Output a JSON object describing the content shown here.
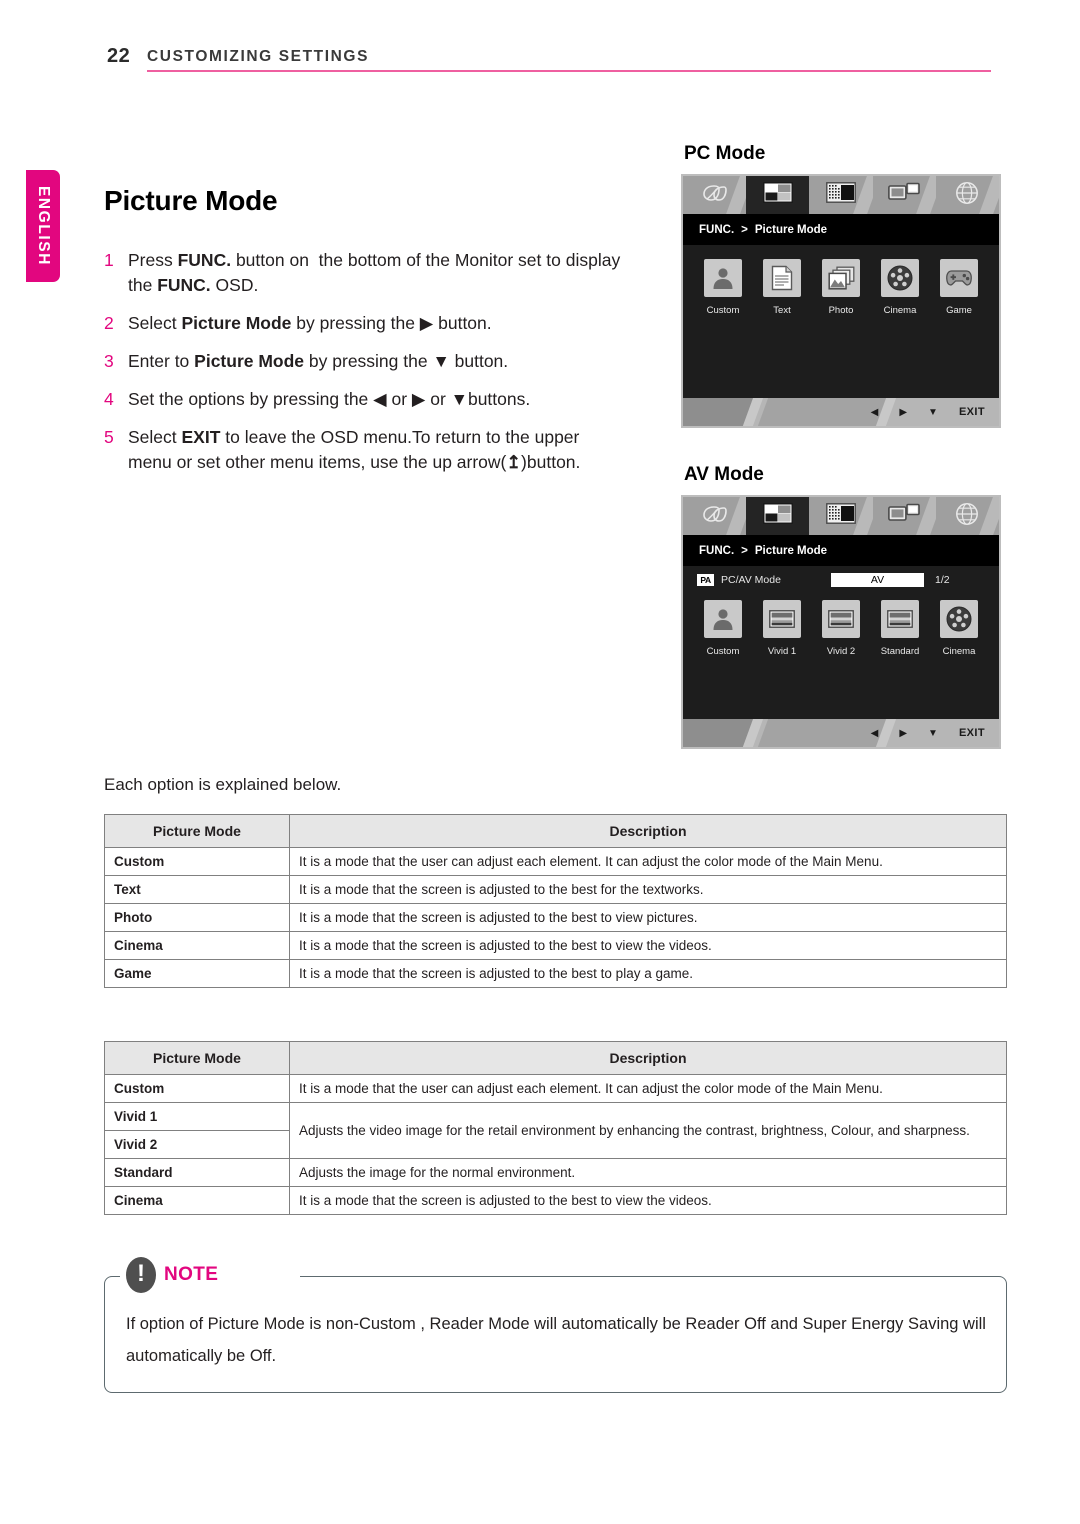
{
  "header": {
    "page_number": "22",
    "title": "CUSTOMIZING SETTINGS",
    "rule_color": "#ef5fa0"
  },
  "language_tab": {
    "label": "ENGLISH",
    "color": "#e2067f"
  },
  "section": {
    "title": "Picture Mode",
    "explain_line": "Each option is explained below."
  },
  "steps": [
    {
      "num": "1",
      "html": "Press <b>FUNC.</b> button on&nbsp; the bottom of the Monitor set to display the <b>FUNC.</b> OSD."
    },
    {
      "num": "2",
      "html": "Select <b>Picture Mode</b> by pressing the ▶ button."
    },
    {
      "num": "3",
      "html": "Enter to <b>Picture Mode</b> by pressing the ▼ button."
    },
    {
      "num": "4",
      "html": "Set the options by pressing the ◀ or ▶ or ▼buttons."
    },
    {
      "num": "5",
      "html": "Select <b>EXIT</b> to leave the OSD menu.To return to the upper menu or set other menu items, use&nbsp;the up arrow(<b>↥</b>)button."
    }
  ],
  "pc_mode": {
    "label": "PC Mode",
    "tabs": [
      {
        "icon": "energy-leaf-icon",
        "active": false
      },
      {
        "icon": "picture-mode-icon",
        "active": true
      },
      {
        "icon": "screen-adjust-icon",
        "active": false
      },
      {
        "icon": "dual-display-icon",
        "active": false
      },
      {
        "icon": "globe-icon",
        "active": false
      }
    ],
    "breadcrumb": {
      "root": "FUNC.",
      "separator": ">",
      "current": "Picture Mode"
    },
    "options": [
      {
        "caption": "Custom",
        "icon": "person-icon"
      },
      {
        "caption": "Text",
        "icon": "document-icon"
      },
      {
        "caption": "Photo",
        "icon": "photo-icon"
      },
      {
        "caption": "Cinema",
        "icon": "film-reel-icon"
      },
      {
        "caption": "Game",
        "icon": "gamepad-icon"
      }
    ],
    "footer_keys": [
      "◀",
      "▶",
      "▼",
      "EXIT"
    ]
  },
  "av_mode": {
    "label": "AV Mode",
    "tabs": [
      {
        "icon": "energy-leaf-icon",
        "active": false
      },
      {
        "icon": "picture-mode-icon",
        "active": true
      },
      {
        "icon": "screen-adjust-icon",
        "active": false
      },
      {
        "icon": "dual-display-icon",
        "active": false
      },
      {
        "icon": "globe-icon",
        "active": false
      }
    ],
    "breadcrumb": {
      "root": "FUNC.",
      "separator": ">",
      "current": "Picture Mode"
    },
    "pcav_row": {
      "badge": "PA",
      "label": "PC/AV Mode",
      "value": "AV",
      "page": "1/2"
    },
    "options": [
      {
        "caption": "Custom",
        "icon": "person-icon"
      },
      {
        "caption": "Vivid 1",
        "icon": "bars-icon"
      },
      {
        "caption": "Vivid 2",
        "icon": "bars-icon"
      },
      {
        "caption": "Standard",
        "icon": "bars-icon"
      },
      {
        "caption": "Cinema",
        "icon": "film-reel-icon"
      }
    ],
    "footer_keys": [
      "◀",
      "▶",
      "▼",
      "EXIT"
    ]
  },
  "table_pc": {
    "headers": [
      "Picture Mode",
      "Description"
    ],
    "rows": [
      [
        "Custom",
        "It is a mode that the user can adjust each element. It can adjust the color mode of the Main Menu."
      ],
      [
        "Text",
        "It is a mode that the screen is adjusted to the best for the textworks."
      ],
      [
        "Photo",
        "It is a mode that the screen is adjusted to the best to view pictures."
      ],
      [
        "Cinema",
        "It is a mode that the screen is adjusted to the best to view the videos."
      ],
      [
        "Game",
        "It is a mode that the screen is adjusted to the best to play a game."
      ]
    ]
  },
  "table_av": {
    "headers": [
      "Picture Mode",
      "Description"
    ],
    "rows": [
      {
        "mode": "Custom",
        "desc": "It is a mode that the user can adjust each element. It can adjust the color mode of the Main Menu."
      },
      {
        "mode": "Vivid 1",
        "desc": "Adjusts the video image for the retail environment by enhancing the contrast, brightness, Colour, and sharpness.",
        "desc_rowspan": 2
      },
      {
        "mode": "Vivid 2"
      },
      {
        "mode": "Standard",
        "desc": "Adjusts the image for the normal environment."
      },
      {
        "mode": "Cinema",
        "desc": "It is a mode that the screen is adjusted to the best to view the videos."
      }
    ]
  },
  "note": {
    "title": "NOTE",
    "icon": "exclamation-icon",
    "accent_color": "#e2067f",
    "text": "If option of Picture Mode is non-Custom , Reader Mode will automatically be Reader Off and Super Energy Saving will automatically be Off."
  }
}
